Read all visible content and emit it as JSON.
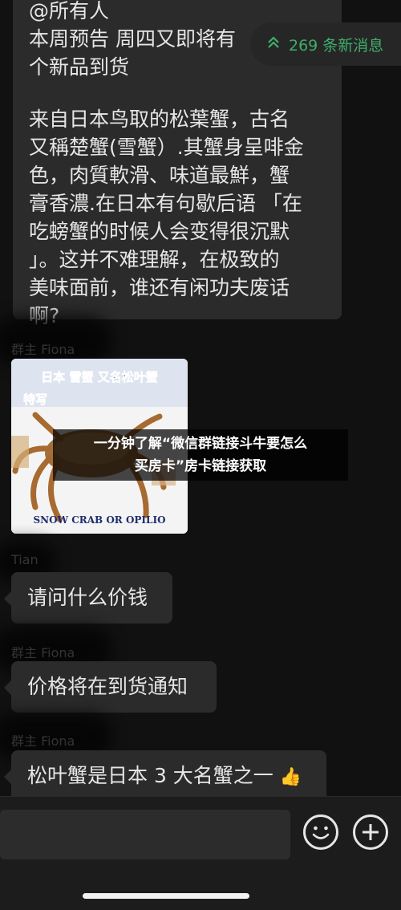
{
  "top_message": {
    "lines": [
      "@所有人",
      "本周预告 周四又即将有",
      "个新品到货",
      "",
      "来自日本鸟取的松葉蟹，古名",
      "又稱楚蟹(雪蟹）.其蟹身呈啡金",
      "色，肉質軟滑、味道最鮮，蟹",
      "膏香濃.在日本有句歇后语 「在",
      "吃螃蟹的时候人会变得很沉默",
      "」。这并不难理解，在极致的",
      "美味面前，谁还有闲功夫废话",
      "啊?"
    ]
  },
  "new_messages": {
    "label": "269 条新消息",
    "icon": "double-chevron-up-icon",
    "color": "#3fae6a"
  },
  "sender_group_owner": "群主 Fiona",
  "sender_tian": "Tian",
  "image_message": {
    "caption_top_line1": "日本 雪蟹 又名松叶蟹",
    "caption_top_line2": "特写",
    "caption_bottom": "SNOW CRAB OR OPILIO"
  },
  "overlay_caption": {
    "line1": "一分钟了解“微信群链接斗牛要怎么",
    "line2": "买房卡”房卡链接获取"
  },
  "messages": [
    {
      "id": "ask_price",
      "text": "请问什么价钱"
    },
    {
      "id": "price_notice",
      "text": "价格将在到货通知"
    },
    {
      "id": "crab_fame",
      "text": "松叶蟹是日本 3 大名蟹之一",
      "emoji": "👍"
    }
  ],
  "input_bar": {
    "emoji_icon": "smiley-icon",
    "plus_icon": "plus-icon"
  }
}
